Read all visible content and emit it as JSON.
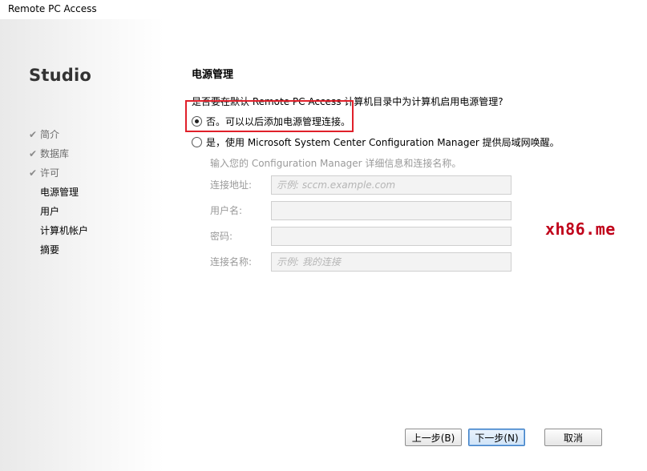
{
  "window": {
    "title": "Remote PC Access"
  },
  "sidebar": {
    "brand": "Studio",
    "steps": [
      {
        "label": "简介",
        "state": "done"
      },
      {
        "label": "数据库",
        "state": "done"
      },
      {
        "label": "许可",
        "state": "done"
      },
      {
        "label": "电源管理",
        "state": "current"
      },
      {
        "label": "用户",
        "state": "todo"
      },
      {
        "label": "计算机帐户",
        "state": "todo"
      },
      {
        "label": "摘要",
        "state": "todo"
      }
    ],
    "check_glyph": "✔"
  },
  "main": {
    "section_title": "电源管理",
    "question": "是否要在默认 Remote PC Access 计算机目录中为计算机启用电源管理?",
    "options": [
      {
        "label": "否。可以以后添加电源管理连接。",
        "checked": true
      },
      {
        "label": "是，使用 Microsoft System Center Configuration Manager 提供局域网唤醒。",
        "checked": false
      }
    ],
    "hint": "输入您的 Configuration Manager 详细信息和连接名称。",
    "fields": {
      "address": {
        "label": "连接地址:",
        "value": "",
        "placeholder": "示例: sccm.example.com"
      },
      "username": {
        "label": "用户名:",
        "value": "",
        "placeholder": ""
      },
      "password": {
        "label": "密码:",
        "value": "",
        "placeholder": ""
      },
      "connection_name": {
        "label": "连接名称:",
        "value": "",
        "placeholder": "示例: 我的连接"
      }
    }
  },
  "buttons": {
    "back": "上一步(B)",
    "next": "下一步(N)",
    "cancel": "取消"
  },
  "watermark": "xh86.me",
  "colors": {
    "highlight": "#e0202a",
    "watermark": "#c0001a",
    "primary_border": "#3f7fc4"
  }
}
